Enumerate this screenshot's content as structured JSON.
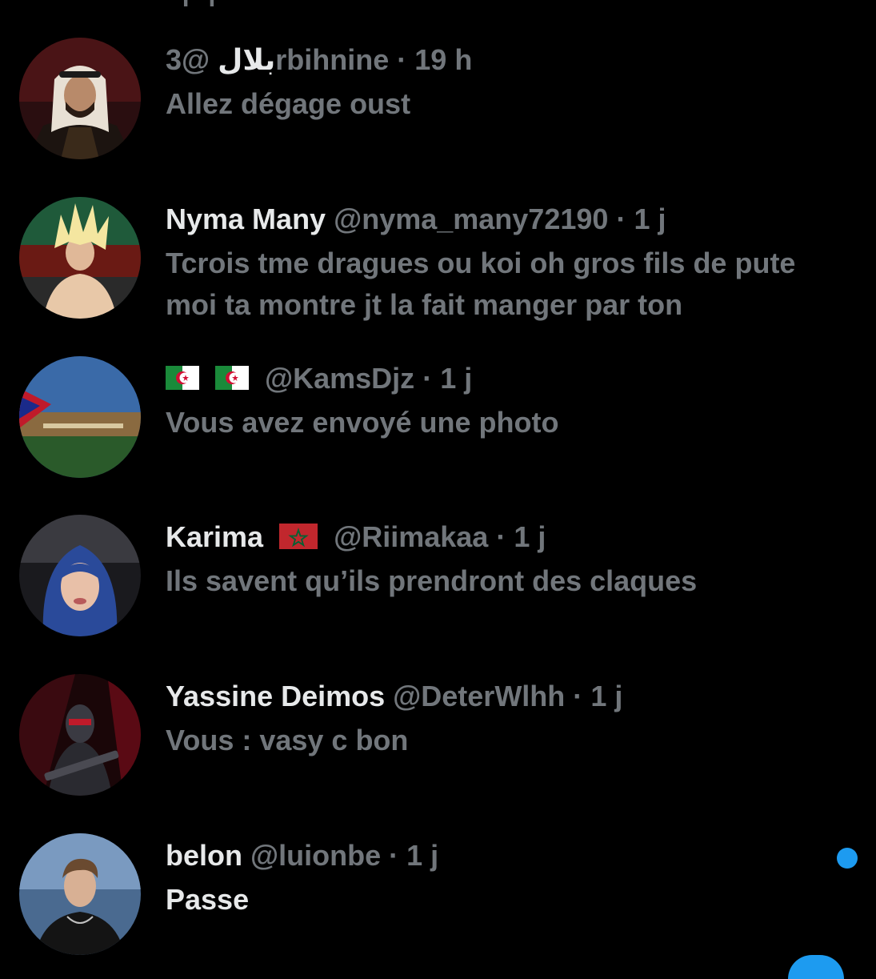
{
  "colors": {
    "background": "#000000",
    "primary_text": "#e7e9ea",
    "secondary_text": "#71767b",
    "accent": "#1d9bf0"
  },
  "conversations": [
    {
      "display_name": "بلال",
      "flags": [],
      "handle": "@3rbihnine",
      "separator": "·",
      "time": "19 h",
      "preview": "Allez dégage  oust",
      "unread": false,
      "avatar": "man-in-keffiyeh-avatar"
    },
    {
      "display_name": "Nyma Many",
      "flags": [],
      "handle": "@nyma_many72190",
      "separator": "·",
      "time": "1 j",
      "preview": "Tcrois tme dragues ou koi oh gros fils de pute moi ta montre jt la fait manger par ton",
      "unread": false,
      "avatar": "anime-character-avatar"
    },
    {
      "display_name": "",
      "flags": [
        "algeria-flag-icon",
        "algeria-flag-icon"
      ],
      "handle": "@KamsDjz",
      "separator": "·",
      "time": "1 j",
      "preview": "Vous avez envoyé une photo",
      "unread": false,
      "avatar": "stadium-avatar"
    },
    {
      "display_name": "Karima",
      "flags": [
        "morocco-flag-icon"
      ],
      "handle": "@Riimakaa",
      "separator": "·",
      "time": "1 j",
      "preview": "Ils savent qu’ils prendront des claques",
      "unread": false,
      "avatar": "woman-in-hijab-avatar"
    },
    {
      "display_name": "Yassine Deimos",
      "flags": [],
      "handle": "@DeterWlhh",
      "separator": "·",
      "time": "1 j",
      "preview": "Vous : vasy c bon",
      "unread": false,
      "avatar": "masked-soldier-avatar"
    },
    {
      "display_name": "belon",
      "flags": [],
      "handle": "@luionbe",
      "separator": "·",
      "time": "1 j",
      "preview": "Passe",
      "unread": true,
      "avatar": "young-man-avatar"
    }
  ]
}
